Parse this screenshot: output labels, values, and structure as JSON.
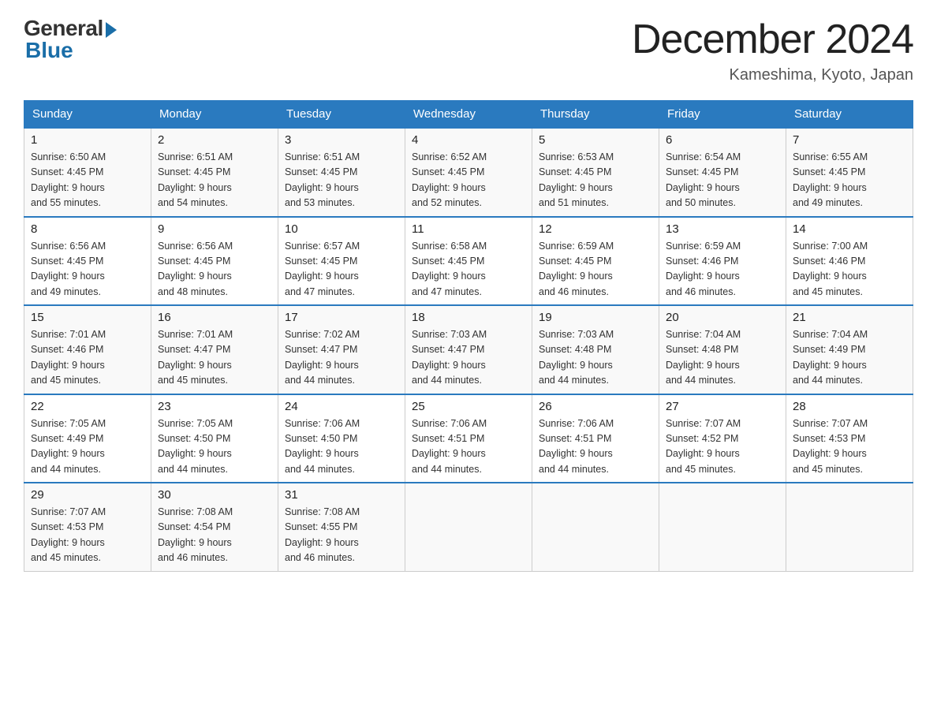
{
  "header": {
    "logo_general": "General",
    "logo_blue": "Blue",
    "month_title": "December 2024",
    "location": "Kameshima, Kyoto, Japan"
  },
  "days_of_week": [
    "Sunday",
    "Monday",
    "Tuesday",
    "Wednesday",
    "Thursday",
    "Friday",
    "Saturday"
  ],
  "weeks": [
    [
      {
        "day": "1",
        "sunrise": "6:50 AM",
        "sunset": "4:45 PM",
        "daylight": "9 hours and 55 minutes."
      },
      {
        "day": "2",
        "sunrise": "6:51 AM",
        "sunset": "4:45 PM",
        "daylight": "9 hours and 54 minutes."
      },
      {
        "day": "3",
        "sunrise": "6:51 AM",
        "sunset": "4:45 PM",
        "daylight": "9 hours and 53 minutes."
      },
      {
        "day": "4",
        "sunrise": "6:52 AM",
        "sunset": "4:45 PM",
        "daylight": "9 hours and 52 minutes."
      },
      {
        "day": "5",
        "sunrise": "6:53 AM",
        "sunset": "4:45 PM",
        "daylight": "9 hours and 51 minutes."
      },
      {
        "day": "6",
        "sunrise": "6:54 AM",
        "sunset": "4:45 PM",
        "daylight": "9 hours and 50 minutes."
      },
      {
        "day": "7",
        "sunrise": "6:55 AM",
        "sunset": "4:45 PM",
        "daylight": "9 hours and 49 minutes."
      }
    ],
    [
      {
        "day": "8",
        "sunrise": "6:56 AM",
        "sunset": "4:45 PM",
        "daylight": "9 hours and 49 minutes."
      },
      {
        "day": "9",
        "sunrise": "6:56 AM",
        "sunset": "4:45 PM",
        "daylight": "9 hours and 48 minutes."
      },
      {
        "day": "10",
        "sunrise": "6:57 AM",
        "sunset": "4:45 PM",
        "daylight": "9 hours and 47 minutes."
      },
      {
        "day": "11",
        "sunrise": "6:58 AM",
        "sunset": "4:45 PM",
        "daylight": "9 hours and 47 minutes."
      },
      {
        "day": "12",
        "sunrise": "6:59 AM",
        "sunset": "4:45 PM",
        "daylight": "9 hours and 46 minutes."
      },
      {
        "day": "13",
        "sunrise": "6:59 AM",
        "sunset": "4:46 PM",
        "daylight": "9 hours and 46 minutes."
      },
      {
        "day": "14",
        "sunrise": "7:00 AM",
        "sunset": "4:46 PM",
        "daylight": "9 hours and 45 minutes."
      }
    ],
    [
      {
        "day": "15",
        "sunrise": "7:01 AM",
        "sunset": "4:46 PM",
        "daylight": "9 hours and 45 minutes."
      },
      {
        "day": "16",
        "sunrise": "7:01 AM",
        "sunset": "4:47 PM",
        "daylight": "9 hours and 45 minutes."
      },
      {
        "day": "17",
        "sunrise": "7:02 AM",
        "sunset": "4:47 PM",
        "daylight": "9 hours and 44 minutes."
      },
      {
        "day": "18",
        "sunrise": "7:03 AM",
        "sunset": "4:47 PM",
        "daylight": "9 hours and 44 minutes."
      },
      {
        "day": "19",
        "sunrise": "7:03 AM",
        "sunset": "4:48 PM",
        "daylight": "9 hours and 44 minutes."
      },
      {
        "day": "20",
        "sunrise": "7:04 AM",
        "sunset": "4:48 PM",
        "daylight": "9 hours and 44 minutes."
      },
      {
        "day": "21",
        "sunrise": "7:04 AM",
        "sunset": "4:49 PM",
        "daylight": "9 hours and 44 minutes."
      }
    ],
    [
      {
        "day": "22",
        "sunrise": "7:05 AM",
        "sunset": "4:49 PM",
        "daylight": "9 hours and 44 minutes."
      },
      {
        "day": "23",
        "sunrise": "7:05 AM",
        "sunset": "4:50 PM",
        "daylight": "9 hours and 44 minutes."
      },
      {
        "day": "24",
        "sunrise": "7:06 AM",
        "sunset": "4:50 PM",
        "daylight": "9 hours and 44 minutes."
      },
      {
        "day": "25",
        "sunrise": "7:06 AM",
        "sunset": "4:51 PM",
        "daylight": "9 hours and 44 minutes."
      },
      {
        "day": "26",
        "sunrise": "7:06 AM",
        "sunset": "4:51 PM",
        "daylight": "9 hours and 44 minutes."
      },
      {
        "day": "27",
        "sunrise": "7:07 AM",
        "sunset": "4:52 PM",
        "daylight": "9 hours and 45 minutes."
      },
      {
        "day": "28",
        "sunrise": "7:07 AM",
        "sunset": "4:53 PM",
        "daylight": "9 hours and 45 minutes."
      }
    ],
    [
      {
        "day": "29",
        "sunrise": "7:07 AM",
        "sunset": "4:53 PM",
        "daylight": "9 hours and 45 minutes."
      },
      {
        "day": "30",
        "sunrise": "7:08 AM",
        "sunset": "4:54 PM",
        "daylight": "9 hours and 46 minutes."
      },
      {
        "day": "31",
        "sunrise": "7:08 AM",
        "sunset": "4:55 PM",
        "daylight": "9 hours and 46 minutes."
      },
      null,
      null,
      null,
      null
    ]
  ]
}
